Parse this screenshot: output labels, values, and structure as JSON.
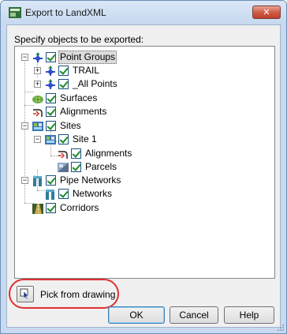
{
  "window": {
    "title": "Export to LandXML",
    "close_glyph": "✕"
  },
  "prompt": "Specify objects to be exported:",
  "tree": [
    {
      "label": "Point Groups",
      "icon": "point-groups-icon",
      "expander": "−",
      "selected": true
    },
    {
      "label": "TRAIL",
      "icon": "point-group-icon",
      "expander": "+"
    },
    {
      "label": "_All Points",
      "icon": "point-group-icon",
      "expander": "+"
    },
    {
      "label": "Surfaces",
      "icon": "surface-icon"
    },
    {
      "label": "Alignments",
      "icon": "alignment-icon"
    },
    {
      "label": "Sites",
      "icon": "sites-icon",
      "expander": "−"
    },
    {
      "label": "Site 1",
      "icon": "site-icon",
      "expander": "−"
    },
    {
      "label": "Alignments",
      "icon": "alignment-icon"
    },
    {
      "label": "Parcels",
      "icon": "parcel-icon"
    },
    {
      "label": "Pipe Networks",
      "icon": "pipe-networks-icon",
      "expander": "−"
    },
    {
      "label": "Networks",
      "icon": "pipe-network-icon"
    },
    {
      "label": "Corridors",
      "icon": "corridor-icon"
    }
  ],
  "pick": {
    "label": "Pick from drawing"
  },
  "buttons": {
    "ok": "OK",
    "cancel": "Cancel",
    "help": "Help"
  },
  "colors": {
    "checkmark": "#1a8a2a",
    "highlight_oval": "#e03030",
    "title_bar": "#c9daf0",
    "close_button": "#cf5d47"
  }
}
